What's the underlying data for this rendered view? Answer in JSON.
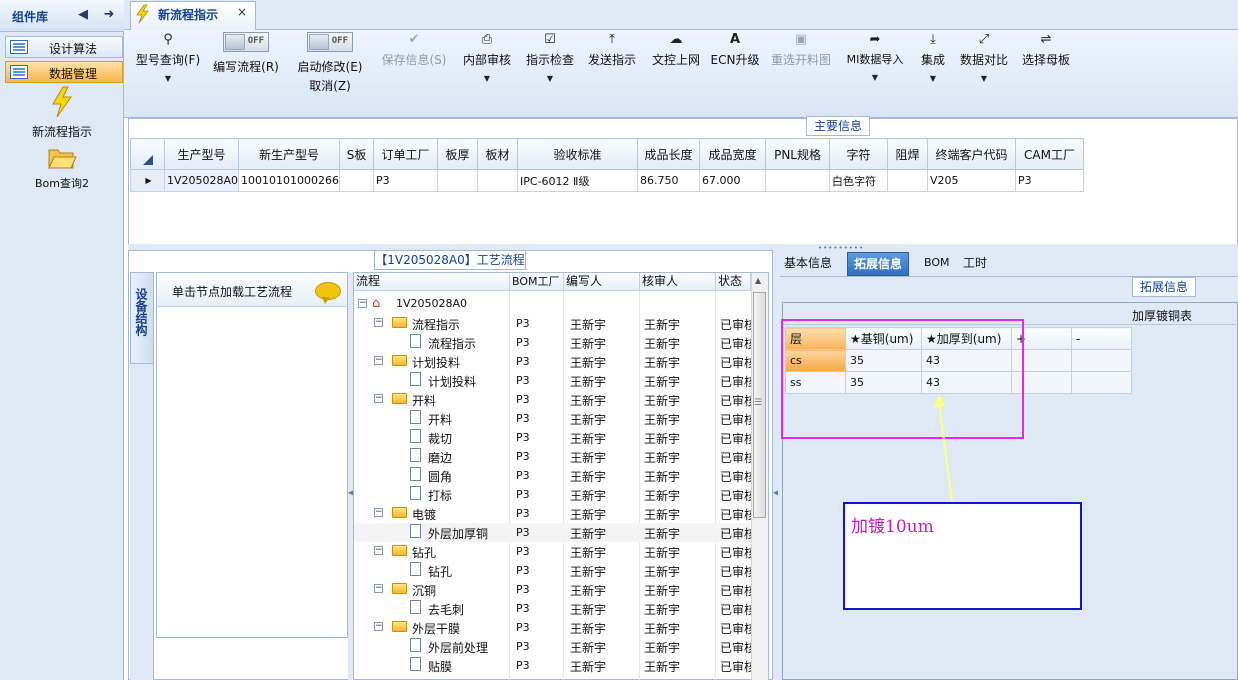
{
  "left_panel": {
    "title": "组件库",
    "categories": [
      {
        "label": "设计算法"
      },
      {
        "label": "数据管理"
      }
    ],
    "tools": [
      {
        "label": "新流程指示",
        "icon": "lightning-icon"
      },
      {
        "label": "Bom查询2",
        "icon": "folder-open-icon"
      }
    ]
  },
  "document_tab": {
    "title": "新流程指示",
    "close": "×"
  },
  "ribbon": {
    "items": [
      {
        "label": "型号查询(F)",
        "icon": "search-icon"
      },
      {
        "label": "编写流程(R)",
        "toggle": "OFF"
      },
      {
        "label": "启动修改(E)",
        "label2": "取消(Z)",
        "toggle": "OFF"
      },
      {
        "label": "保存信息(S)",
        "icon": "check-icon",
        "disabled": true
      },
      {
        "label": "内部审核",
        "icon": "print-icon"
      },
      {
        "label": "指示检查",
        "icon": "checkbox-icon"
      },
      {
        "label": "发送指示",
        "icon": "upload-icon"
      },
      {
        "label": "文控上网",
        "icon": "cloud-upload-icon"
      },
      {
        "label": "ECN升级",
        "icon": "text-a-icon"
      },
      {
        "label": "重选开料图",
        "icon": "image-icon",
        "disabled": true
      },
      {
        "label": "MI数据导入",
        "icon": "sign-in-icon"
      },
      {
        "label": "集成",
        "icon": "download-icon"
      },
      {
        "label": "数据对比",
        "icon": "compress-icon"
      },
      {
        "label": "选择母板",
        "icon": "shuffle-icon"
      }
    ]
  },
  "main_info": {
    "title": "主要信息",
    "columns": [
      "生产型号",
      "新生产型号",
      "S板",
      "订单工厂",
      "板厚",
      "板材",
      "验收标准",
      "成品长度",
      "成品宽度",
      "PNL规格",
      "字符",
      "阻焊",
      "终端客户代码",
      "CAM工厂"
    ],
    "rows": [
      [
        "1V205028A0",
        "10010101000266",
        "",
        "P3",
        "",
        "",
        "IPC-6012 Ⅱ级",
        "86.750",
        "67.000",
        "",
        "白色字符",
        "",
        "V205",
        "P3"
      ]
    ]
  },
  "process_flow": {
    "title": "【1V205028A0】工艺流程",
    "side_tab": "设备结构",
    "node_hint": "单击节点加载工艺流程",
    "columns": [
      "流程",
      "BOM工厂",
      "编写人",
      "核审人",
      "状态"
    ],
    "root": "1V205028A0",
    "rows": [
      {
        "name": "流程指示",
        "type": "folder",
        "bom": "P3",
        "writer": "王新宇",
        "reviewer": "王新宇",
        "status": "已审核"
      },
      {
        "name": "流程指示",
        "type": "doc",
        "bom": "P3",
        "writer": "王新宇",
        "reviewer": "王新宇",
        "status": "已审核"
      },
      {
        "name": "计划投料",
        "type": "folder",
        "bom": "P3",
        "writer": "王新宇",
        "reviewer": "王新宇",
        "status": "已审核"
      },
      {
        "name": "计划投料",
        "type": "doc",
        "bom": "P3",
        "writer": "王新宇",
        "reviewer": "王新宇",
        "status": "已审核"
      },
      {
        "name": "开料",
        "type": "folder",
        "bom": "P3",
        "writer": "王新宇",
        "reviewer": "王新宇",
        "status": "已审核"
      },
      {
        "name": "开料",
        "type": "doc",
        "bom": "P3",
        "writer": "王新宇",
        "reviewer": "王新宇",
        "status": "已审核"
      },
      {
        "name": "裁切",
        "type": "doc",
        "bom": "P3",
        "writer": "王新宇",
        "reviewer": "王新宇",
        "status": "已审核"
      },
      {
        "name": "磨边",
        "type": "doc",
        "bom": "P3",
        "writer": "王新宇",
        "reviewer": "王新宇",
        "status": "已审核"
      },
      {
        "name": "圆角",
        "type": "doc",
        "bom": "P3",
        "writer": "王新宇",
        "reviewer": "王新宇",
        "status": "已审核"
      },
      {
        "name": "打标",
        "type": "doc",
        "bom": "P3",
        "writer": "王新宇",
        "reviewer": "王新宇",
        "status": "已审核"
      },
      {
        "name": "电镀",
        "type": "folder",
        "bom": "P3",
        "writer": "王新宇",
        "reviewer": "王新宇",
        "status": "已审核"
      },
      {
        "name": "外层加厚铜",
        "type": "doc",
        "bom": "P3",
        "writer": "王新宇",
        "reviewer": "王新宇",
        "status": "已审核",
        "selected": true
      },
      {
        "name": "钻孔",
        "type": "folder",
        "bom": "P3",
        "writer": "王新宇",
        "reviewer": "王新宇",
        "status": "已审核"
      },
      {
        "name": "钻孔",
        "type": "doc",
        "bom": "P3",
        "writer": "王新宇",
        "reviewer": "王新宇",
        "status": "已审核"
      },
      {
        "name": "沉铜",
        "type": "folder",
        "bom": "P3",
        "writer": "王新宇",
        "reviewer": "王新宇",
        "status": "已审核"
      },
      {
        "name": "去毛刺",
        "type": "doc",
        "bom": "P3",
        "writer": "王新宇",
        "reviewer": "王新宇",
        "status": "已审核"
      },
      {
        "name": "外层干膜",
        "type": "folder",
        "bom": "P3",
        "writer": "王新宇",
        "reviewer": "王新宇",
        "status": "已审核"
      },
      {
        "name": "外层前处理",
        "type": "doc",
        "bom": "P3",
        "writer": "王新宇",
        "reviewer": "王新宇",
        "status": "已审核"
      },
      {
        "name": "贴膜",
        "type": "doc",
        "bom": "P3",
        "writer": "王新宇",
        "reviewer": "王新宇",
        "status": "已审核"
      }
    ]
  },
  "ext_tabs": [
    "基本信息",
    "拓展信息",
    "BOM",
    "工时"
  ],
  "ext_info": {
    "title": "拓展信息",
    "subtitle": "加厚镀铜表",
    "columns": [
      "层",
      "★基铜(um)",
      "★加厚到(um)",
      "+",
      "-"
    ],
    "rows": [
      [
        "cs",
        "35",
        "43",
        "",
        ""
      ],
      [
        "ss",
        "35",
        "43",
        "",
        ""
      ]
    ]
  },
  "annotation": {
    "text": "加镀10um"
  },
  "colors": {
    "annotation_text": "#c01ec0",
    "highlight_box": "#e02ce0",
    "annotation_box": "#1414c8",
    "arrow": "#ffff80",
    "active_tab": "#2f6fc0"
  }
}
